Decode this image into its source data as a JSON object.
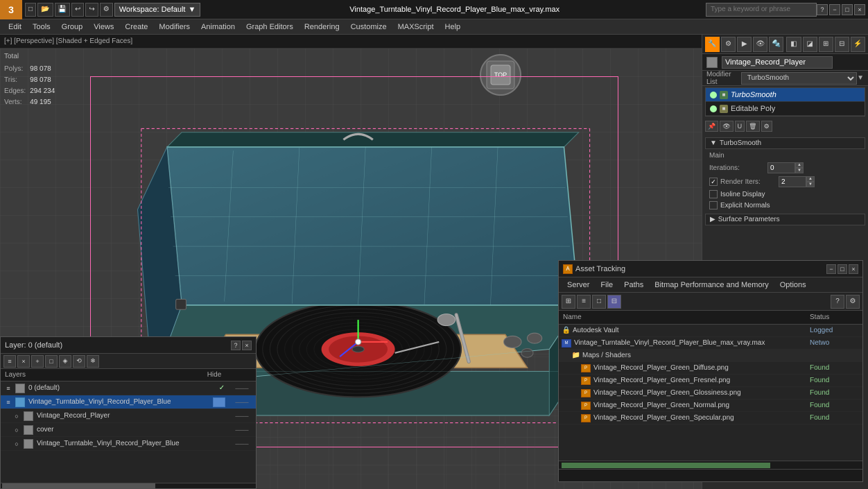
{
  "titlebar": {
    "logo": "3",
    "filename": "Vintage_Turntable_Vinyl_Record_Player_Blue_max_vray.max",
    "workspace_label": "Workspace: Default",
    "search_placeholder": "Type a keyword or phrase",
    "win_minimize": "−",
    "win_maximize": "□",
    "win_close": "×"
  },
  "menubar": {
    "items": [
      "Edit",
      "Tools",
      "Group",
      "Views",
      "Create",
      "Modifiers",
      "Animation",
      "Graph Editors",
      "Rendering",
      "Customize",
      "MAXScript",
      "Help"
    ]
  },
  "viewport": {
    "label": "[+] [Perspective] [Shaded + Edged Faces]",
    "stats": {
      "labels": [
        "Polys:",
        "Tris:",
        "Edges:",
        "Verts:"
      ],
      "col_header": "Total",
      "values": [
        "98 078",
        "98 078",
        "294 234",
        "49 195"
      ]
    }
  },
  "right_panel": {
    "object_name": "Vintage_Record_Player",
    "modifier_list_label": "Modifier List",
    "modifiers": [
      {
        "name": "TurboSmooth",
        "type": "turbosmooth",
        "selected": true,
        "light": true
      },
      {
        "name": "Editable Poly",
        "type": "editable",
        "selected": false,
        "light": true
      }
    ],
    "section_title": "TurboSmooth",
    "main_label": "Main",
    "properties": {
      "iterations_label": "Iterations:",
      "iterations_value": "0",
      "render_iters_label": "Render Iters:",
      "render_iters_value": "2",
      "isoline_label": "Isoline Display",
      "explicit_label": "Explicit Normals",
      "surface_params_label": "Surface Parameters"
    }
  },
  "layers_panel": {
    "title": "Layer: 0 (default)",
    "help_btn": "?",
    "close_btn": "×",
    "col_name": "Layers",
    "col_hide": "Hide",
    "rows": [
      {
        "indent": 0,
        "icon": "≡",
        "name": "0 (default)",
        "checked": true,
        "color": "#888888",
        "hide": ""
      },
      {
        "indent": 0,
        "icon": "≡",
        "name": "Vintage_Turntable_Vinyl_Record_Player_Blue",
        "checked": false,
        "color": "#5599cc",
        "hide": "",
        "selected": true
      },
      {
        "indent": 1,
        "icon": "○",
        "name": "Vintage_Record_Player",
        "checked": false,
        "color": "#888888",
        "hide": ""
      },
      {
        "indent": 1,
        "icon": "○",
        "name": "cover",
        "checked": false,
        "color": "#888888",
        "hide": ""
      },
      {
        "indent": 1,
        "icon": "○",
        "name": "Vintage_Turntable_Vinyl_Record_Player_Blue",
        "checked": false,
        "color": "#888888",
        "hide": ""
      }
    ]
  },
  "asset_panel": {
    "title": "Asset Tracking",
    "col_name": "Name",
    "col_status": "Status",
    "menu_items": [
      "Server",
      "File",
      "Paths",
      "Bitmap Performance and Memory",
      "Options"
    ],
    "rows": [
      {
        "type": "vault",
        "name": "Autodesk Vault",
        "status": "Logged",
        "status_class": "logged",
        "indent": 0
      },
      {
        "type": "max",
        "name": "Vintage_Turntable_Vinyl_Record_Player_Blue_max_vray.max",
        "status": "Netwo",
        "status_class": "network",
        "indent": 0
      },
      {
        "type": "folder",
        "name": "Maps / Shaders",
        "status": "",
        "status_class": "",
        "indent": 1
      },
      {
        "type": "png",
        "name": "Vintage_Record_Player_Green_Diffuse.png",
        "status": "Found",
        "status_class": "found",
        "indent": 2
      },
      {
        "type": "png",
        "name": "Vintage_Record_Player_Green_Fresnel.png",
        "status": "Found",
        "status_class": "found",
        "indent": 2
      },
      {
        "type": "png",
        "name": "Vintage_Record_Player_Green_Glossiness.png",
        "status": "Found",
        "status_class": "found",
        "indent": 2
      },
      {
        "type": "png",
        "name": "Vintage_Record_Player_Green_Normal.png",
        "status": "Found",
        "status_class": "found",
        "indent": 2
      },
      {
        "type": "png",
        "name": "Vintage_Record_Player_Green_Specular.png",
        "status": "Found",
        "status_class": "found",
        "indent": 2
      }
    ]
  },
  "colors": {
    "accent_orange": "#ff8800",
    "selection_pink": "#ff69b4",
    "found_green": "#88cc88",
    "bg_dark": "#1e1e1e",
    "bg_panel": "#2b2b2b",
    "layer_blue": "#5599cc"
  },
  "icons": {
    "turbosmooth": "TS",
    "editable": "EP",
    "vault": "🔒",
    "folder": "📁",
    "png_ext": "PNG",
    "max_ext": "MAX"
  }
}
